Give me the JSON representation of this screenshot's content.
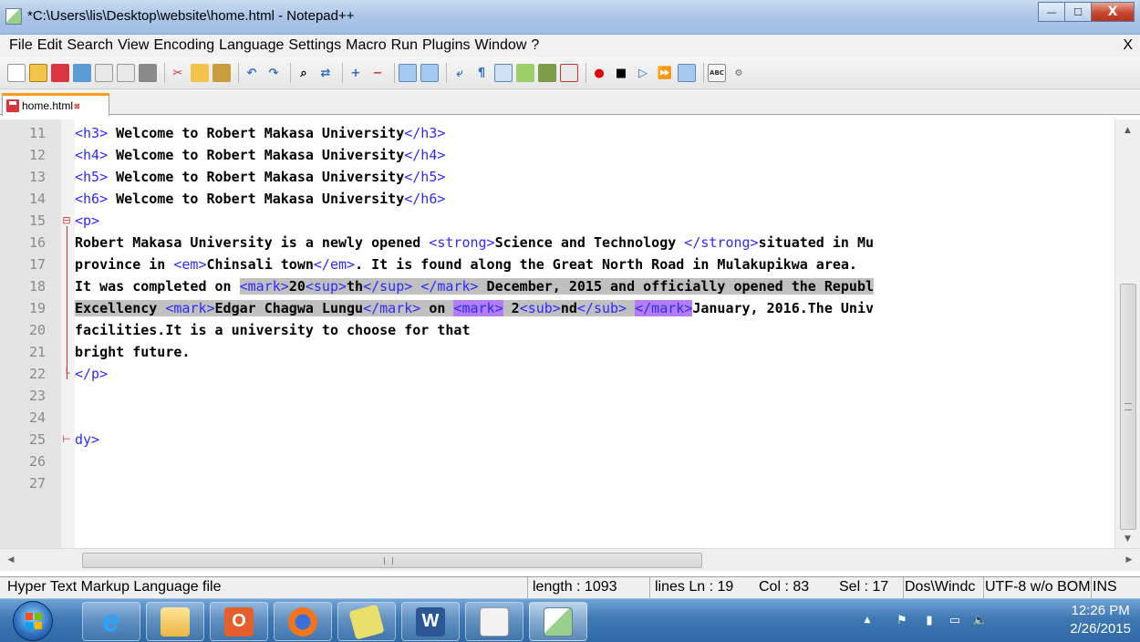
{
  "window": {
    "title": "*C:\\Users\\lis\\Desktop\\website\\home.html - Notepad++",
    "minimize": "—",
    "maximize": "☐",
    "close": "X"
  },
  "menu": {
    "items": [
      "File",
      "Edit",
      "Search",
      "View",
      "Encoding",
      "Language",
      "Settings",
      "Macro",
      "Run",
      "Plugins",
      "Window",
      "?"
    ],
    "close_doc": "X"
  },
  "tab": {
    "label": "home.html",
    "close": "⊠"
  },
  "editor": {
    "line_numbers": [
      "11",
      "12",
      "13",
      "14",
      "15",
      "16",
      "17",
      "18",
      "19",
      "20",
      "21",
      "22",
      "23",
      "24",
      "25",
      "26",
      "27"
    ],
    "lines": [
      [
        {
          "t": "<h3>",
          "c": "tag"
        },
        {
          "t": " Welcome to Robert Makasa University",
          "c": "txt"
        },
        {
          "t": "</h3>",
          "c": "tag"
        }
      ],
      [
        {
          "t": "<h4>",
          "c": "tag"
        },
        {
          "t": " Welcome to Robert Makasa University",
          "c": "txt"
        },
        {
          "t": "</h4>",
          "c": "tag"
        }
      ],
      [
        {
          "t": "<h5>",
          "c": "tag"
        },
        {
          "t": " Welcome to Robert Makasa University",
          "c": "txt"
        },
        {
          "t": "</h5>",
          "c": "tag"
        }
      ],
      [
        {
          "t": "<h6>",
          "c": "tag"
        },
        {
          "t": " Welcome to Robert Makasa University",
          "c": "txt"
        },
        {
          "t": "</h6>",
          "c": "tag"
        }
      ],
      [
        {
          "t": "<p>",
          "c": "tag"
        }
      ],
      [
        {
          "t": "Robert Makasa University is a newly opened ",
          "c": "txt"
        },
        {
          "t": "<strong>",
          "c": "tag"
        },
        {
          "t": "Science and Technology ",
          "c": "txt"
        },
        {
          "t": "</strong>",
          "c": "tag"
        },
        {
          "t": "situated in Mu",
          "c": "txt"
        }
      ],
      [
        {
          "t": "province in ",
          "c": "txt"
        },
        {
          "t": "<em>",
          "c": "tag"
        },
        {
          "t": "Chinsali town",
          "c": "txt"
        },
        {
          "t": "</em>",
          "c": "tag"
        },
        {
          "t": ". It is found along the Great North Road in Mulakupikwa area.",
          "c": "txt"
        }
      ],
      [
        {
          "t": "It was completed on ",
          "c": "txt"
        },
        {
          "t": "<mark>",
          "c": "tag sel"
        },
        {
          "t": "20",
          "c": "txt sel"
        },
        {
          "t": "<sup>",
          "c": "tag sel"
        },
        {
          "t": "th",
          "c": "txt sel"
        },
        {
          "t": "</sup>",
          "c": "tag sel"
        },
        {
          "t": " ",
          "c": "sel"
        },
        {
          "t": "</mark>",
          "c": "tag sel"
        },
        {
          "t": " December, 2015 and officially opened the Republ",
          "c": "txt sel"
        }
      ],
      [
        {
          "t": "Excellency ",
          "c": "txt sel"
        },
        {
          "t": "<mark>",
          "c": "tag sel"
        },
        {
          "t": "Edgar Chagwa Lungu",
          "c": "txt sel"
        },
        {
          "t": "</mark>",
          "c": "tag sel"
        },
        {
          "t": " on ",
          "c": "txt sel"
        },
        {
          "t": "<mark>",
          "c": "tag match"
        },
        {
          "t": " 2",
          "c": "txt sel"
        },
        {
          "t": "<sub>",
          "c": "tag sel"
        },
        {
          "t": "nd",
          "c": "txt sel"
        },
        {
          "t": "</sub>",
          "c": "tag sel"
        },
        {
          "t": " ",
          "c": "sel"
        },
        {
          "t": "</mark>",
          "c": "tag match"
        },
        {
          "t": "January, 2016.The Univ",
          "c": "txt"
        }
      ],
      [
        {
          "t": "facilities.It is a university to choose for that",
          "c": "txt"
        }
      ],
      [
        {
          "t": "bright future.",
          "c": "txt"
        }
      ],
      [
        {
          "t": "</p>",
          "c": "tag"
        }
      ],
      [],
      [],
      [
        {
          "t": "dy>",
          "c": "tag"
        }
      ],
      [],
      []
    ]
  },
  "status": {
    "file_type": "Hyper Text Markup Language file",
    "length": "length : 1093",
    "lines": "lines Ln : 19",
    "col": "Col : 83",
    "sel": "Sel : 17",
    "eol": "Dos\\Windc",
    "encoding": "UTF-8 w/o BOM",
    "mode": "INS"
  },
  "taskbar": {
    "apps": [
      "windows-start",
      "internet-explorer",
      "file-explorer",
      "media-player",
      "firefox",
      "sticky-notes",
      "word",
      "paint",
      "notepad-plus-plus"
    ],
    "time": "12:26 PM",
    "date": "2/26/2015"
  },
  "colors": {
    "tag": "#2b2bff",
    "selection": "#c0c0c0",
    "brace_match": "#b57df5",
    "active_tab": "#fa9c1a"
  }
}
